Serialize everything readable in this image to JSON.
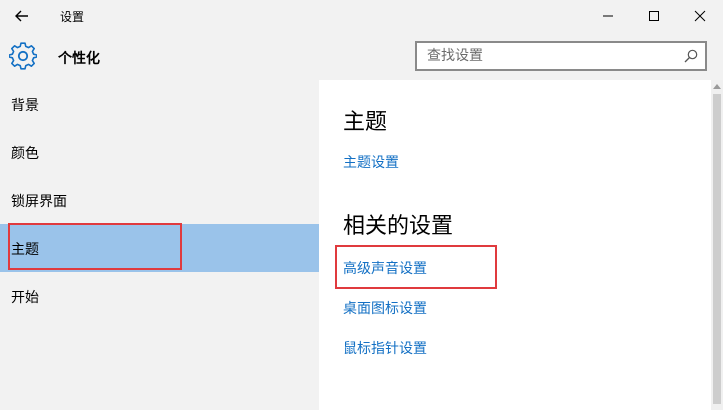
{
  "window": {
    "title": "设置",
    "back_icon": "arrow-left-icon",
    "controls": [
      "minimize-icon",
      "maximize-icon",
      "close-icon"
    ]
  },
  "header": {
    "icon": "gear-icon",
    "title": "个性化",
    "search_placeholder": "查找设置",
    "search_icon": "search-icon"
  },
  "sidebar": {
    "items": [
      {
        "label": "背景",
        "active": false
      },
      {
        "label": "颜色",
        "active": false
      },
      {
        "label": "锁屏界面",
        "active": false
      },
      {
        "label": "主题",
        "active": true
      },
      {
        "label": "开始",
        "active": false
      }
    ]
  },
  "main": {
    "theme_heading": "主题",
    "theme_settings_link": "主题设置",
    "related_heading": "相关的设置",
    "related_links": [
      "高级声音设置",
      "桌面图标设置",
      "鼠标指针设置"
    ]
  },
  "colors": {
    "accent_link": "#1370c4",
    "active_item": "#9ac3ea",
    "highlight_border": "#e03a3e",
    "chrome_bg": "#f2f2f2"
  }
}
